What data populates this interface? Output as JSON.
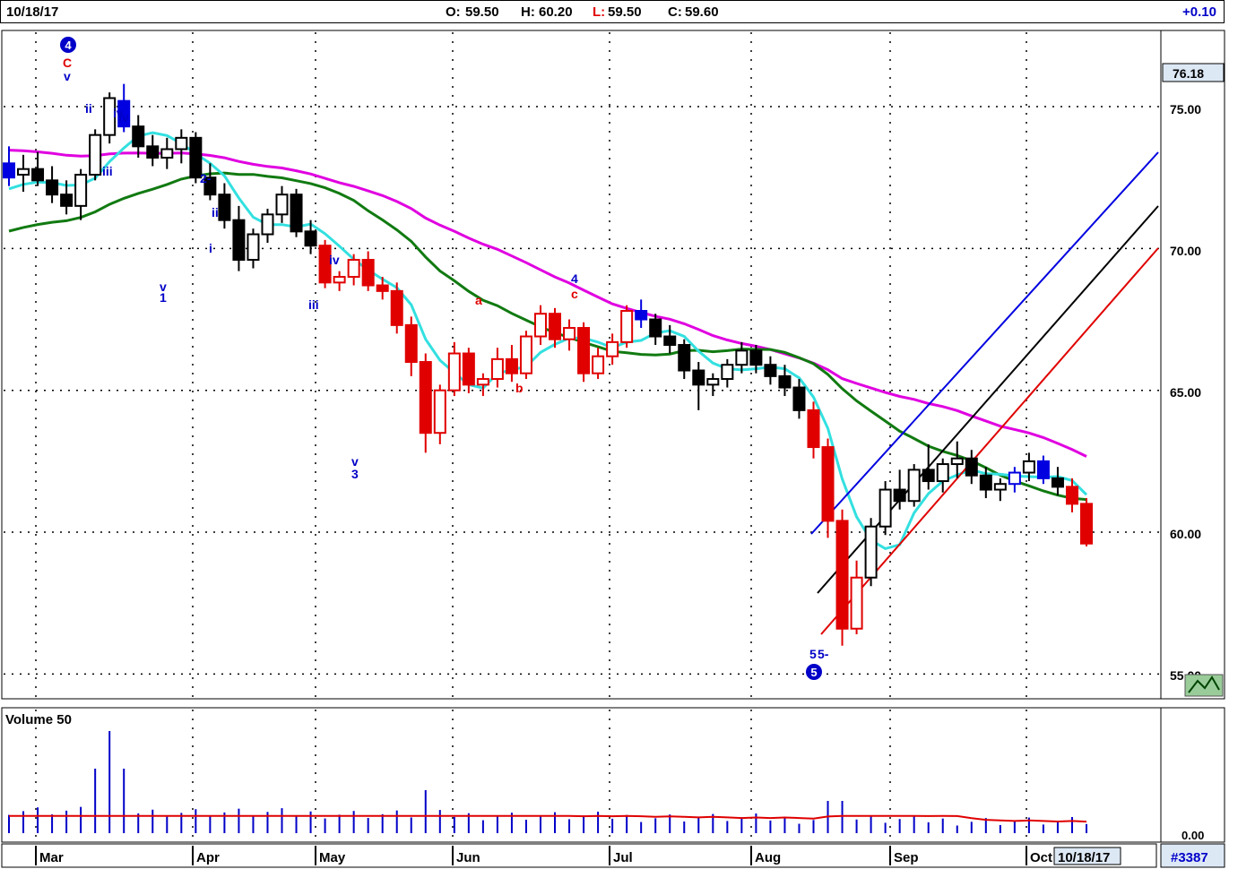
{
  "header": {
    "date": "10/18/17",
    "open_label": "O:",
    "open": "59.50",
    "high_label": "H:",
    "high": "60.20",
    "low_label": "L:",
    "low": "59.50",
    "close_label": "C:",
    "close": "59.60",
    "change": "+0.10"
  },
  "price_panel": {
    "current_price_tag": "76.18",
    "yticks": [
      "75.00",
      "70.00",
      "65.00",
      "60.00",
      "55.00"
    ]
  },
  "volume_panel": {
    "title": "Volume 50",
    "ytick": "0.00"
  },
  "footer": {
    "months": [
      "Mar",
      "Apr",
      "May",
      "Jun",
      "Jul",
      "Aug",
      "Sep",
      "Oct"
    ],
    "date_box": "10/18/17",
    "chart_id": "#3387"
  },
  "wave_labels": [
    {
      "text": "C",
      "color": "red"
    },
    {
      "text": "v",
      "color": "blue"
    },
    {
      "text": "ii",
      "color": "blue"
    },
    {
      "text": "iv",
      "color": "blue"
    },
    {
      "text": "iii",
      "color": "blue"
    },
    {
      "text": "iv",
      "color": "blue"
    },
    {
      "text": "2-",
      "color": "blue"
    },
    {
      "text": "ii",
      "color": "blue"
    },
    {
      "text": "i",
      "color": "blue"
    },
    {
      "text": "v",
      "color": "blue"
    },
    {
      "text": "1",
      "color": "blue"
    },
    {
      "text": "iv",
      "color": "blue"
    },
    {
      "text": "iii",
      "color": "blue"
    },
    {
      "text": "v",
      "color": "blue"
    },
    {
      "text": "3",
      "color": "blue"
    },
    {
      "text": "a",
      "color": "red"
    },
    {
      "text": "b",
      "color": "red"
    },
    {
      "text": "4",
      "color": "blue"
    },
    {
      "text": "c",
      "color": "red"
    },
    {
      "text": "5",
      "color": "blue"
    },
    {
      "text": "5-",
      "color": "blue"
    }
  ],
  "circle_labels": [
    "4",
    "5"
  ],
  "chart_data": {
    "type": "candlestick",
    "ylim": [
      54,
      78
    ],
    "months": [
      "Mar",
      "Apr",
      "May",
      "Jun",
      "Jul",
      "Aug",
      "Sep",
      "Oct"
    ],
    "ohlc": [
      [
        73.0,
        73.6,
        72.2,
        72.5
      ],
      [
        72.6,
        73.3,
        72.0,
        72.8
      ],
      [
        72.8,
        73.4,
        72.2,
        72.4
      ],
      [
        72.4,
        72.9,
        71.6,
        71.9
      ],
      [
        71.9,
        72.4,
        71.2,
        71.5
      ],
      [
        71.5,
        72.8,
        71.0,
        72.6
      ],
      [
        72.6,
        74.2,
        72.4,
        74.0
      ],
      [
        74.0,
        75.5,
        73.7,
        75.3
      ],
      [
        75.2,
        75.8,
        74.1,
        74.3
      ],
      [
        74.3,
        74.7,
        73.2,
        73.6
      ],
      [
        73.6,
        74.0,
        72.9,
        73.2
      ],
      [
        73.2,
        73.9,
        72.8,
        73.5
      ],
      [
        73.5,
        74.2,
        73.0,
        73.9
      ],
      [
        73.9,
        74.1,
        72.3,
        72.5
      ],
      [
        72.5,
        73.0,
        71.7,
        71.9
      ],
      [
        71.9,
        72.3,
        70.7,
        71.0
      ],
      [
        71.0,
        71.5,
        69.2,
        69.6
      ],
      [
        69.6,
        70.7,
        69.3,
        70.5
      ],
      [
        70.5,
        71.4,
        70.2,
        71.2
      ],
      [
        71.2,
        72.2,
        70.9,
        71.9
      ],
      [
        71.9,
        72.1,
        70.4,
        70.6
      ],
      [
        70.6,
        71.0,
        69.8,
        70.1
      ],
      [
        70.1,
        70.3,
        68.6,
        68.8
      ],
      [
        68.8,
        69.2,
        68.5,
        69.0
      ],
      [
        69.0,
        69.8,
        68.7,
        69.6
      ],
      [
        69.6,
        69.9,
        68.5,
        68.7
      ],
      [
        68.7,
        69.0,
        68.2,
        68.5
      ],
      [
        68.5,
        68.8,
        67.0,
        67.3
      ],
      [
        67.3,
        67.6,
        65.5,
        66.0
      ],
      [
        66.0,
        66.3,
        62.8,
        63.5
      ],
      [
        63.5,
        65.2,
        63.1,
        65.0
      ],
      [
        65.0,
        66.7,
        64.8,
        66.3
      ],
      [
        66.3,
        66.5,
        64.9,
        65.2
      ],
      [
        65.2,
        65.6,
        64.8,
        65.4
      ],
      [
        65.4,
        66.5,
        65.1,
        66.1
      ],
      [
        66.1,
        66.6,
        65.3,
        65.6
      ],
      [
        65.6,
        67.1,
        65.4,
        66.9
      ],
      [
        66.9,
        68.0,
        66.6,
        67.7
      ],
      [
        67.7,
        67.9,
        66.5,
        66.8
      ],
      [
        66.8,
        67.5,
        66.4,
        67.2
      ],
      [
        67.2,
        67.4,
        65.3,
        65.6
      ],
      [
        65.6,
        66.5,
        65.4,
        66.2
      ],
      [
        66.2,
        67.0,
        65.9,
        66.7
      ],
      [
        66.7,
        68.0,
        66.5,
        67.8
      ],
      [
        67.8,
        68.2,
        67.2,
        67.5
      ],
      [
        67.5,
        67.7,
        66.6,
        66.9
      ],
      [
        66.9,
        67.3,
        66.3,
        66.6
      ],
      [
        66.6,
        66.8,
        65.4,
        65.7
      ],
      [
        65.7,
        66.0,
        64.3,
        65.2
      ],
      [
        65.2,
        65.6,
        64.8,
        65.4
      ],
      [
        65.4,
        66.1,
        65.1,
        65.9
      ],
      [
        65.9,
        66.7,
        65.6,
        66.4
      ],
      [
        66.4,
        66.6,
        65.6,
        65.9
      ],
      [
        65.9,
        66.2,
        65.2,
        65.5
      ],
      [
        65.5,
        65.9,
        64.8,
        65.1
      ],
      [
        65.1,
        65.4,
        64.0,
        64.3
      ],
      [
        64.3,
        64.6,
        62.6,
        63.0
      ],
      [
        63.0,
        63.3,
        59.8,
        60.4
      ],
      [
        60.4,
        60.8,
        56.0,
        56.6
      ],
      [
        56.6,
        59.0,
        56.4,
        58.4
      ],
      [
        58.4,
        60.5,
        58.1,
        60.2
      ],
      [
        60.2,
        61.8,
        59.9,
        61.5
      ],
      [
        61.5,
        62.2,
        60.8,
        61.1
      ],
      [
        61.1,
        62.4,
        60.9,
        62.2
      ],
      [
        62.2,
        63.1,
        61.5,
        61.8
      ],
      [
        61.8,
        62.6,
        61.4,
        62.4
      ],
      [
        62.4,
        63.2,
        61.9,
        62.6
      ],
      [
        62.6,
        62.9,
        61.7,
        62.0
      ],
      [
        62.0,
        62.3,
        61.2,
        61.5
      ],
      [
        61.5,
        61.9,
        61.1,
        61.7
      ],
      [
        61.7,
        62.3,
        61.4,
        62.1
      ],
      [
        62.1,
        62.8,
        61.8,
        62.5
      ],
      [
        62.5,
        62.7,
        61.7,
        61.9
      ],
      [
        61.9,
        62.3,
        61.3,
        61.6
      ],
      [
        61.6,
        61.9,
        60.7,
        61.0
      ],
      [
        61.0,
        61.2,
        59.5,
        59.6
      ]
    ],
    "ma_fast_visible": true,
    "ma_mid_visible": true,
    "ma_slow_visible": true,
    "volume_ylim": [
      0,
      1
    ]
  }
}
